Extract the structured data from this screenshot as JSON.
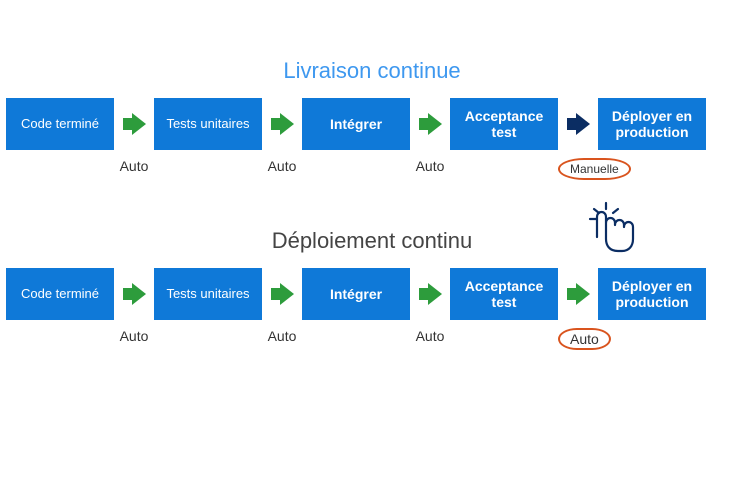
{
  "titles": {
    "delivery": "Livraison continue",
    "deployment": "Déploiement continu"
  },
  "stages": {
    "code": "Code terminé",
    "unit": "Tests unitaires",
    "integrate": "Intégrer",
    "acceptance": "Acceptance test",
    "deploy": "Déployer en production"
  },
  "labels": {
    "auto": "Auto",
    "manual": "Manuelle"
  },
  "colors": {
    "stage_bg": "#0f79d8",
    "arrow_auto": "#2d9c3c",
    "arrow_manual": "#0b2d63",
    "circle": "#d9541e",
    "title_accent": "#3e98ef"
  },
  "pipelines": {
    "delivery": {
      "arrows": [
        "auto",
        "auto",
        "auto",
        "manual"
      ],
      "arrow_labels": [
        "auto",
        "auto",
        "auto",
        "manual_circled"
      ]
    },
    "deployment": {
      "arrows": [
        "auto",
        "auto",
        "auto",
        "auto"
      ],
      "arrow_labels": [
        "auto",
        "auto",
        "auto",
        "auto_circled"
      ]
    }
  }
}
